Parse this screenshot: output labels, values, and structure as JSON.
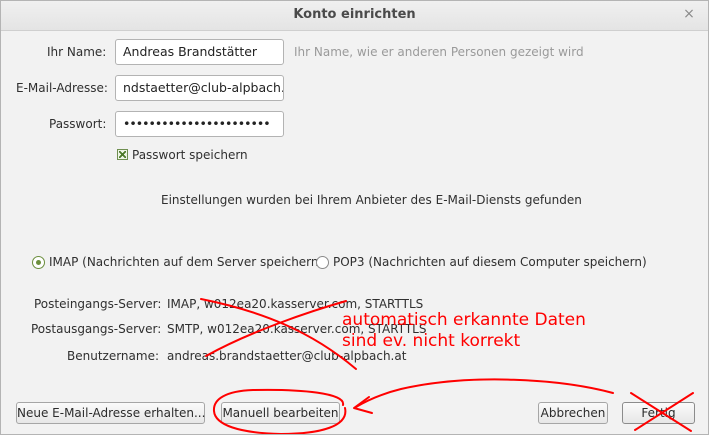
{
  "window": {
    "title": "Konto einrichten",
    "close_glyph": "×"
  },
  "form": {
    "name_label": "Ihr Name:",
    "name_value": "Andreas Brandstätter",
    "name_hint": "Ihr Name, wie er anderen Personen gezeigt wird",
    "email_label": "E-Mail-Adresse:",
    "email_value": "ndstaetter@club-alpbach.at",
    "password_label": "Passwort:",
    "password_value": "•••••••••••••••••••••••",
    "remember_label": "Passwort speichern",
    "remember_checked": true
  },
  "status": {
    "message": "Einstellungen wurden bei Ihrem Anbieter des E-Mail-Diensts gefunden"
  },
  "protocol": {
    "imap_label": "IMAP (Nachrichten auf dem Server speichern)",
    "pop3_label": "POP3 (Nachrichten auf diesem Computer speichern)",
    "selected": "IMAP"
  },
  "servers": {
    "incoming_label": "Posteingangs-Server:",
    "incoming_value": "IMAP, w012ea20.kasserver.com, STARTTLS",
    "outgoing_label": "Postausgangs-Server:",
    "outgoing_value": "SMTP, w012ea20.kasserver.com, STARTTLS",
    "username_label": "Benutzername:",
    "username_value": "andreas.brandstaetter@club-alpbach.at"
  },
  "buttons": {
    "new_address": "Neue E-Mail-Adresse erhalten...",
    "manual": "Manuell bearbeiten",
    "cancel": "Abbrechen",
    "done": "Fertig"
  },
  "annotation": {
    "line1": "automatisch erkannte Daten",
    "line2": "sind ev. nicht korrekt",
    "color": "#ff0000"
  }
}
